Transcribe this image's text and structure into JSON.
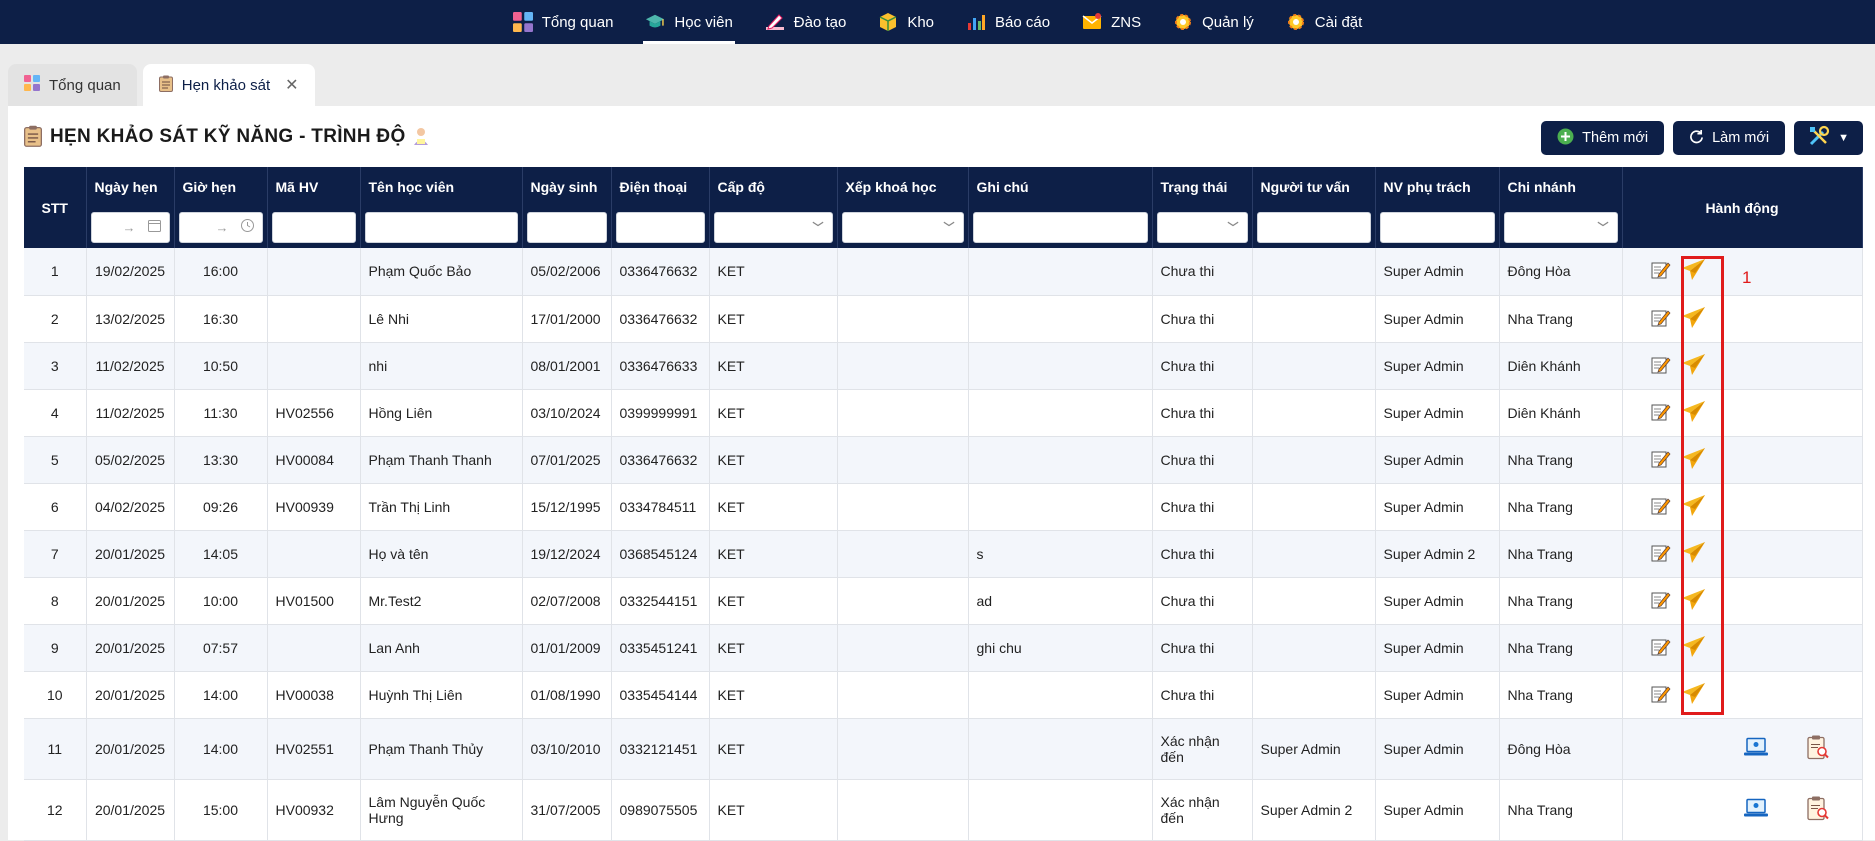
{
  "nav": {
    "items": [
      {
        "label": "Tổng quan",
        "icon": "dashboard-icon"
      },
      {
        "label": "Học viên",
        "icon": "graduation-cap-icon"
      },
      {
        "label": "Đào tạo",
        "icon": "pencil-icon"
      },
      {
        "label": "Kho",
        "icon": "box-icon"
      },
      {
        "label": "Báo cáo",
        "icon": "bar-chart-icon"
      },
      {
        "label": "ZNS",
        "icon": "mail-icon"
      },
      {
        "label": "Quản lý",
        "icon": "gear-icon"
      },
      {
        "label": "Cài đặt",
        "icon": "gear-icon"
      }
    ],
    "active": "Học viên"
  },
  "tabs": [
    {
      "label": "Tổng quan"
    },
    {
      "label": "Hẹn khảo sát"
    }
  ],
  "page": {
    "title": "HẸN KHẢO SÁT KỸ NĂNG - TRÌNH ĐỘ"
  },
  "toolbar": {
    "add_label": "Thêm mới",
    "refresh_label": "Làm mới"
  },
  "table": {
    "headers": {
      "stt": "STT",
      "date": "Ngày hẹn",
      "time": "Giờ hẹn",
      "code": "Mã HV",
      "name": "Tên học viên",
      "dob": "Ngày sinh",
      "phone": "Điện thoại",
      "level": "Cấp độ",
      "course": "Xếp khoá học",
      "note": "Ghi chú",
      "status": "Trạng thái",
      "advisor": "Người tư vấn",
      "staff": "NV phụ trách",
      "branch": "Chi nhánh",
      "actions": "Hành động"
    },
    "filters": {
      "date_arrow": "→",
      "time_arrow": "→"
    },
    "rows": [
      {
        "stt": "1",
        "date": "19/02/2025",
        "time": "16:00",
        "code": "",
        "name": "Phạm Quốc Bảo",
        "dob": "05/02/2006",
        "phone": "0336476632",
        "level": "KET",
        "course": "",
        "note": "",
        "status": "Chưa thi",
        "advisor": "",
        "staff": "Super Admin",
        "branch": "Đông Hòa",
        "actions": "edit-send"
      },
      {
        "stt": "2",
        "date": "13/02/2025",
        "time": "16:30",
        "code": "",
        "name": "Lê Nhi",
        "dob": "17/01/2000",
        "phone": "0336476632",
        "level": "KET",
        "course": "",
        "note": "",
        "status": "Chưa thi",
        "advisor": "",
        "staff": "Super Admin",
        "branch": "Nha Trang",
        "actions": "edit-send"
      },
      {
        "stt": "3",
        "date": "11/02/2025",
        "time": "10:50",
        "code": "",
        "name": "nhi",
        "dob": "08/01/2001",
        "phone": "0336476633",
        "level": "KET",
        "course": "",
        "note": "",
        "status": "Chưa thi",
        "advisor": "",
        "staff": "Super Admin",
        "branch": "Diên Khánh",
        "actions": "edit-send"
      },
      {
        "stt": "4",
        "date": "11/02/2025",
        "time": "11:30",
        "code": "HV02556",
        "name": "Hồng Liên",
        "dob": "03/10/2024",
        "phone": "0399999991",
        "level": "KET",
        "course": "",
        "note": "",
        "status": "Chưa thi",
        "advisor": "",
        "staff": "Super Admin",
        "branch": "Diên Khánh",
        "actions": "edit-send"
      },
      {
        "stt": "5",
        "date": "05/02/2025",
        "time": "13:30",
        "code": "HV00084",
        "name": "Phạm Thanh Thanh",
        "dob": "07/01/2025",
        "phone": "0336476632",
        "level": "KET",
        "course": "",
        "note": "",
        "status": "Chưa thi",
        "advisor": "",
        "staff": "Super Admin",
        "branch": "Nha Trang",
        "actions": "edit-send"
      },
      {
        "stt": "6",
        "date": "04/02/2025",
        "time": "09:26",
        "code": "HV00939",
        "name": "Trần Thị Linh",
        "dob": "15/12/1995",
        "phone": "0334784511",
        "level": "KET",
        "course": "",
        "note": "",
        "status": "Chưa thi",
        "advisor": "",
        "staff": "Super Admin",
        "branch": "Nha Trang",
        "actions": "edit-send"
      },
      {
        "stt": "7",
        "date": "20/01/2025",
        "time": "14:05",
        "code": "",
        "name": "Họ và tên",
        "dob": "19/12/2024",
        "phone": "0368545124",
        "level": "KET",
        "course": "",
        "note": "s",
        "status": "Chưa thi",
        "advisor": "",
        "staff": "Super Admin 2",
        "branch": "Nha Trang",
        "actions": "edit-send"
      },
      {
        "stt": "8",
        "date": "20/01/2025",
        "time": "10:00",
        "code": "HV01500",
        "name": "Mr.Test2",
        "dob": "02/07/2008",
        "phone": "0332544151",
        "level": "KET",
        "course": "",
        "note": "ad",
        "status": "Chưa thi",
        "advisor": "",
        "staff": "Super Admin",
        "branch": "Nha Trang",
        "actions": "edit-send"
      },
      {
        "stt": "9",
        "date": "20/01/2025",
        "time": "07:57",
        "code": "",
        "name": "Lan Anh",
        "dob": "01/01/2009",
        "phone": "0335451241",
        "level": "KET",
        "course": "",
        "note": "ghi chu",
        "status": "Chưa thi",
        "advisor": "",
        "staff": "Super Admin",
        "branch": "Nha Trang",
        "actions": "edit-send"
      },
      {
        "stt": "10",
        "date": "20/01/2025",
        "time": "14:00",
        "code": "HV00038",
        "name": "Huỳnh Thị Liên",
        "dob": "01/08/1990",
        "phone": "0335454144",
        "level": "KET",
        "course": "",
        "note": "",
        "status": "Chưa thi",
        "advisor": "",
        "staff": "Super Admin",
        "branch": "Nha Trang",
        "actions": "edit-send"
      },
      {
        "stt": "11",
        "date": "20/01/2025",
        "time": "14:00",
        "code": "HV02551",
        "name": "Phạm Thanh Thủy",
        "dob": "03/10/2010",
        "phone": "0332121451",
        "level": "KET",
        "course": "",
        "note": "",
        "status": "Xác nhận đến",
        "advisor": "Super Admin",
        "staff": "Super Admin",
        "branch": "Đông Hòa",
        "actions": "exam-review"
      },
      {
        "stt": "12",
        "date": "20/01/2025",
        "time": "15:00",
        "code": "HV00932",
        "name": "Lâm Nguyễn Quốc Hưng",
        "dob": "31/07/2005",
        "phone": "0989075505",
        "level": "KET",
        "course": "",
        "note": "",
        "status": "Xác nhận đến",
        "advisor": "Super Admin 2",
        "staff": "Super Admin",
        "branch": "Nha Trang",
        "actions": "exam-review"
      }
    ]
  },
  "annotation": {
    "label": "1",
    "color": "#e01b1b"
  },
  "colors": {
    "nav_bg": "#0d1f47",
    "header_bg": "#0d1f47",
    "send_icon": "#f5b820",
    "highlight": "#e01b1b"
  }
}
